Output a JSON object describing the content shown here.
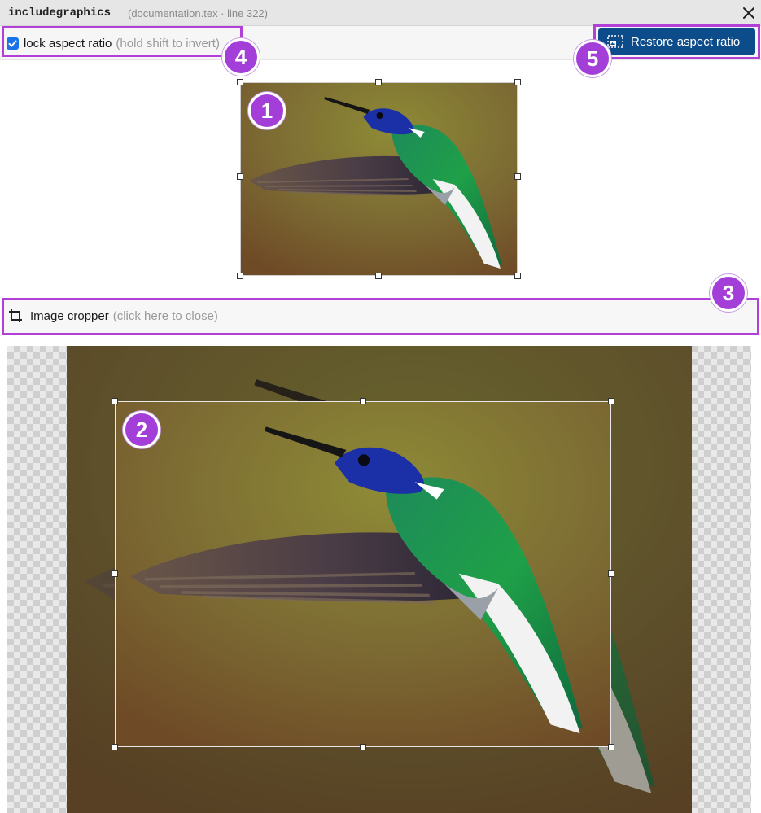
{
  "titlebar": {
    "command": "includegraphics",
    "file_info": "(documentation.tex · line 322)",
    "close_icon": "close-icon"
  },
  "options": {
    "lock_checked": true,
    "lock_label": "lock aspect ratio",
    "lock_hint": "(hold shift to invert)",
    "restore_label": "Restore aspect ratio",
    "restore_icon": "restore-aspect-icon"
  },
  "cropper": {
    "label": "Image cropper",
    "hint": "(click here to close)",
    "icon": "crop-icon"
  },
  "annotations": {
    "badge1": "1",
    "badge2": "2",
    "badge3": "3",
    "badge4": "4",
    "badge5": "5",
    "color": "#a43ed9"
  },
  "colors": {
    "accent_button": "#0d4c8b",
    "checkbox": "#1a73e8",
    "highlight": "#b33fd9"
  }
}
